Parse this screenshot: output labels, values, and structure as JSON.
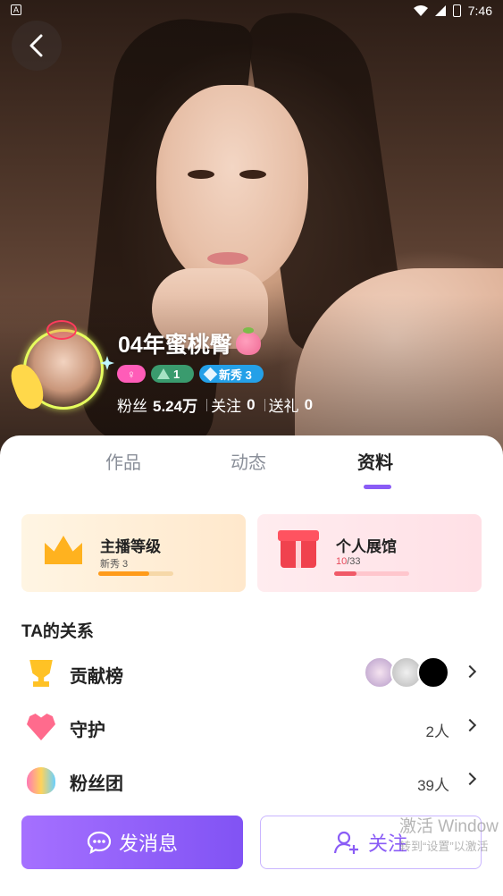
{
  "status_bar": {
    "left_icon": "A",
    "time": "7:46"
  },
  "profile": {
    "name": "04年蜜桃臀",
    "badges": {
      "gender": "♀",
      "level": "1",
      "rookie": "新秀 3"
    },
    "stats": {
      "fans_label": "粉丝",
      "fans_value": "5.24万",
      "follow_label": "关注",
      "follow_value": "0",
      "gift_label": "送礼",
      "gift_value": "0"
    }
  },
  "tabs": [
    "作品",
    "动态",
    "资料"
  ],
  "active_tab": "资料",
  "cards": {
    "anchor_level": {
      "title": "主播等级",
      "sub": "新秀 3",
      "progress": 0.68
    },
    "gallery": {
      "title": "个人展馆",
      "progress_current": "10",
      "progress_total": "/33",
      "progress": 0.3
    }
  },
  "relations": {
    "title": "TA的关系",
    "rows": [
      {
        "label": "贡献榜",
        "value": ""
      },
      {
        "label": "守护",
        "value": "2人"
      },
      {
        "label": "粉丝团",
        "value": "39人"
      }
    ]
  },
  "actions": {
    "message": "发消息",
    "follow": "关注"
  },
  "watermark": {
    "line1": "激活 Window",
    "line2": "转到“设置”以激活"
  },
  "colors": {
    "accent": "#8a5cf6",
    "gender_badge": "#ff5cb8",
    "level_badge": "#3a9b6e",
    "rookie_badge": "#24a0e8"
  }
}
